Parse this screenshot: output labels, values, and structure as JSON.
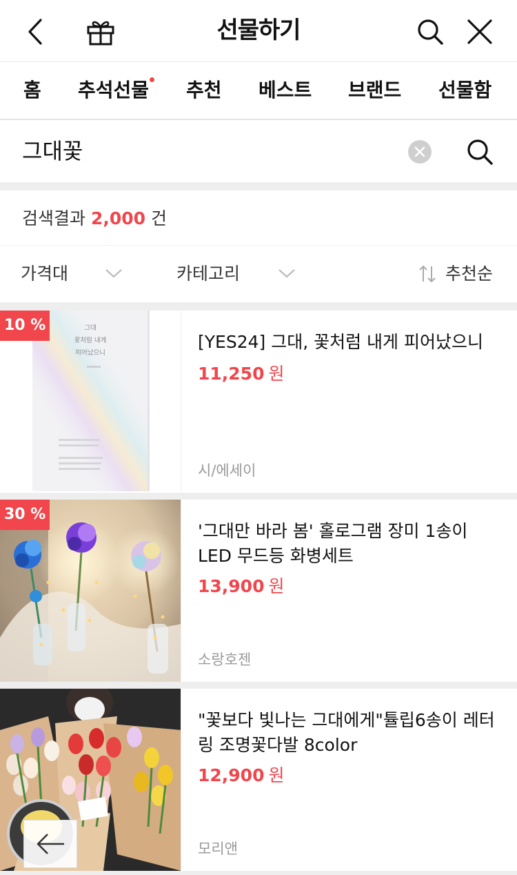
{
  "header": {
    "title": "선물하기",
    "icons": [
      "back-icon",
      "gift-icon",
      "search-icon",
      "close-icon"
    ]
  },
  "tabs": [
    {
      "label": "홈"
    },
    {
      "label": "추석선물",
      "has_dot": true
    },
    {
      "label": "추천"
    },
    {
      "label": "베스트"
    },
    {
      "label": "브랜드"
    },
    {
      "label": "선물함"
    }
  ],
  "search": {
    "query": "그대꽃"
  },
  "results": {
    "prefix": "검색결과",
    "count": "2,000",
    "suffix": "건"
  },
  "filters": {
    "price_label": "가격대",
    "category_label": "카테고리",
    "sort_label": "추천순"
  },
  "products": [
    {
      "discount": "10 %",
      "name": "[YES24] 그대, 꽃처럼 내게 피어났으니",
      "price": "11,250",
      "currency": "원",
      "shop": "시/에세이",
      "cover_text": {
        "title_line1": "그대",
        "title_line2": "꽃처럼 내게",
        "title_line3": "피어났으니"
      }
    },
    {
      "discount": "30 %",
      "name": "'그대만 바라 봄' 홀로그램 장미 1송이 LED 무드등 화병세트",
      "price": "13,900",
      "currency": "원",
      "shop": "소랑호젠"
    },
    {
      "name": "\"꽃보다 빛나는 그대에게\"튤립6송이 레터링 조명꽃다발 8color",
      "price": "12,900",
      "currency": "원",
      "shop": "모리앤"
    }
  ],
  "colors": {
    "accent": "#f0464c",
    "muted": "#999999",
    "divider": "#eeeeee"
  }
}
